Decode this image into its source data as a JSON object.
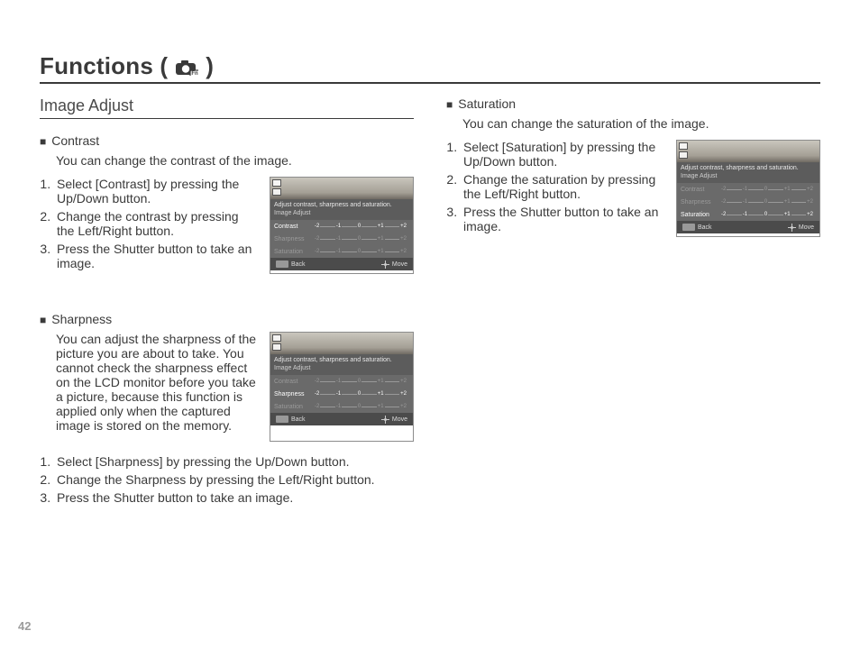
{
  "page_number": "42",
  "title": {
    "prefix": "Functions (",
    "suffix": ")"
  },
  "section_heading": "Image Adjust",
  "lcd_common": {
    "banner_line1": "Adjust contrast, sharpness and saturation.",
    "banner_line2": "Image Adjust",
    "rows": {
      "contrast": "Contrast",
      "sharpness": "Sharpness",
      "saturation": "Saturation"
    },
    "ticks": [
      "-2",
      "-1",
      "0",
      "+1",
      "+2"
    ],
    "back": "Back",
    "move": "Move"
  },
  "contrast": {
    "label": "Contrast",
    "desc": "You can change the contrast of the image.",
    "steps": [
      "Select [Contrast] by pressing the Up/Down button.",
      "Change the contrast by pressing the Left/Right button.",
      "Press the Shutter button to take an image."
    ]
  },
  "sharpness": {
    "label": "Sharpness",
    "desc": "You can adjust the sharpness of the picture you are about to take. You cannot check the sharpness effect on the LCD monitor before you take a picture, because this function is applied only when the captured image is stored on the memory.",
    "steps": [
      "Select [Sharpness] by pressing the Up/Down button.",
      "Change the Sharpness by pressing the Left/Right button.",
      "Press the Shutter button to take an image."
    ]
  },
  "saturation": {
    "label": "Saturation",
    "desc": "You can change the saturation of the image.",
    "steps": [
      "Select [Saturation] by pressing the Up/Down button.",
      "Change the saturation by pressing the Left/Right button.",
      "Press the Shutter button to take an image."
    ]
  }
}
